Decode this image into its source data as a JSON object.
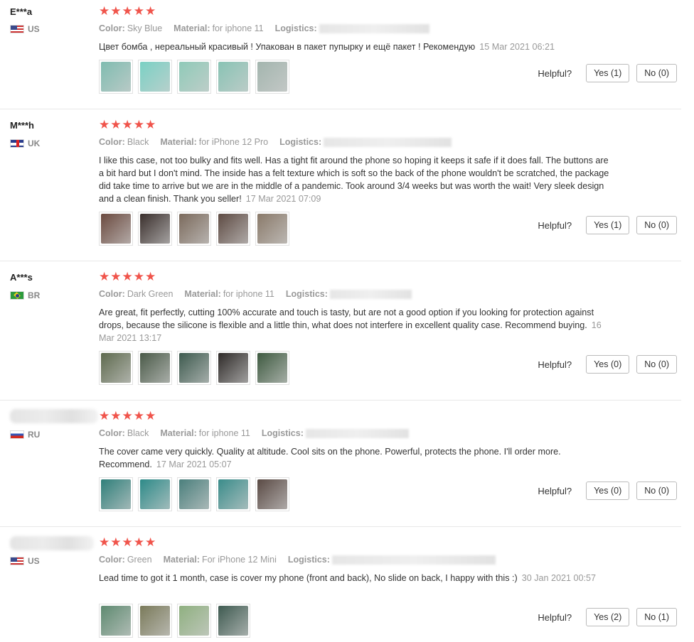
{
  "labels": {
    "color": "Color:",
    "material": "Material:",
    "logistics": "Logistics:",
    "helpful": "Helpful?"
  },
  "reviews": [
    {
      "user": "E***a",
      "country": "US",
      "flag": "us",
      "stars": "★★★★★",
      "color": "Sky Blue",
      "material": "for iphone 11",
      "text": "Цвет бомба , нереальный красивый ! Упакован в пакет пупырку и ещё пакет ! Рекомендую",
      "date": "15 Mar 2021 06:21",
      "yes": "Yes (1)",
      "no": "No (0)",
      "thumb_colors": [
        "#7fbcb0",
        "#7ad1c4",
        "#8fcab8",
        "#88c3b4",
        "#a3b5ae"
      ]
    },
    {
      "user": "M***h",
      "country": "UK",
      "flag": "uk",
      "stars": "★★★★★",
      "color": "Black",
      "material": "for iPhone 12 Pro",
      "text": "I like this case, not too bulky and fits well. Has a tight fit around the phone so hoping it keeps it safe if it does fall. The buttons are a bit hard but I don't mind. The inside has a felt texture which is soft so the back of the phone wouldn't be scratched, the package did take time to arrive but we are in the middle of a pandemic. Took around 3/4 weeks but was worth the wait! Very sleek design and a clean finish. Thank you seller!",
      "date": "17 Mar 2021 07:09",
      "yes": "Yes (1)",
      "no": "No (0)",
      "thumb_colors": [
        "#6b4a3f",
        "#3a2f2c",
        "#7b6a5c",
        "#5e4b43",
        "#8a7a6a"
      ]
    },
    {
      "user": "A***s",
      "country": "BR",
      "flag": "br",
      "stars": "★★★★★",
      "color": "Dark Green",
      "material": "for iphone 11",
      "text": "Are great, fit perfectly, cutting 100% accurate and touch is tasty, but are not a good option if you looking for protection against drops, because the silicone is flexible and a little thin, what does not interfere in excellent quality case. Recommend buying.",
      "date": "16 Mar 2021 13:17",
      "yes": "Yes (0)",
      "no": "No (0)",
      "thumb_colors": [
        "#5e6a4e",
        "#4a5a48",
        "#3d5a4e",
        "#2e2a28",
        "#3e5a40"
      ]
    },
    {
      "user": "",
      "country": "RU",
      "flag": "ru",
      "stars": "★★★★★",
      "color": "Black",
      "material": "for iphone 11",
      "text": "The cover came very quickly. Quality at altitude. Cool sits on the phone. Powerful, protects the phone. I'll order more. Recommend.",
      "date": "17 Mar 2021 05:07",
      "yes": "Yes (0)",
      "no": "No (0)",
      "thumb_colors": [
        "#2f7f7a",
        "#2d8a88",
        "#4a7f7c",
        "#3a8c8a",
        "#5a4a44"
      ]
    },
    {
      "user": "",
      "country": "US",
      "flag": "us",
      "stars": "★★★★★",
      "color": "Green",
      "material": "For iPhone 12 Mini",
      "text": "Lead time to got it 1 month, case is cover my phone (front and back), No slide on back, I happy with this :)",
      "date": "30 Jan 2021 00:57",
      "yes": "Yes (2)",
      "no": "No (1)",
      "thumb_colors": [
        "#5e8a70",
        "#7a7a5a",
        "#8fb080",
        "#3e5a50"
      ]
    }
  ]
}
